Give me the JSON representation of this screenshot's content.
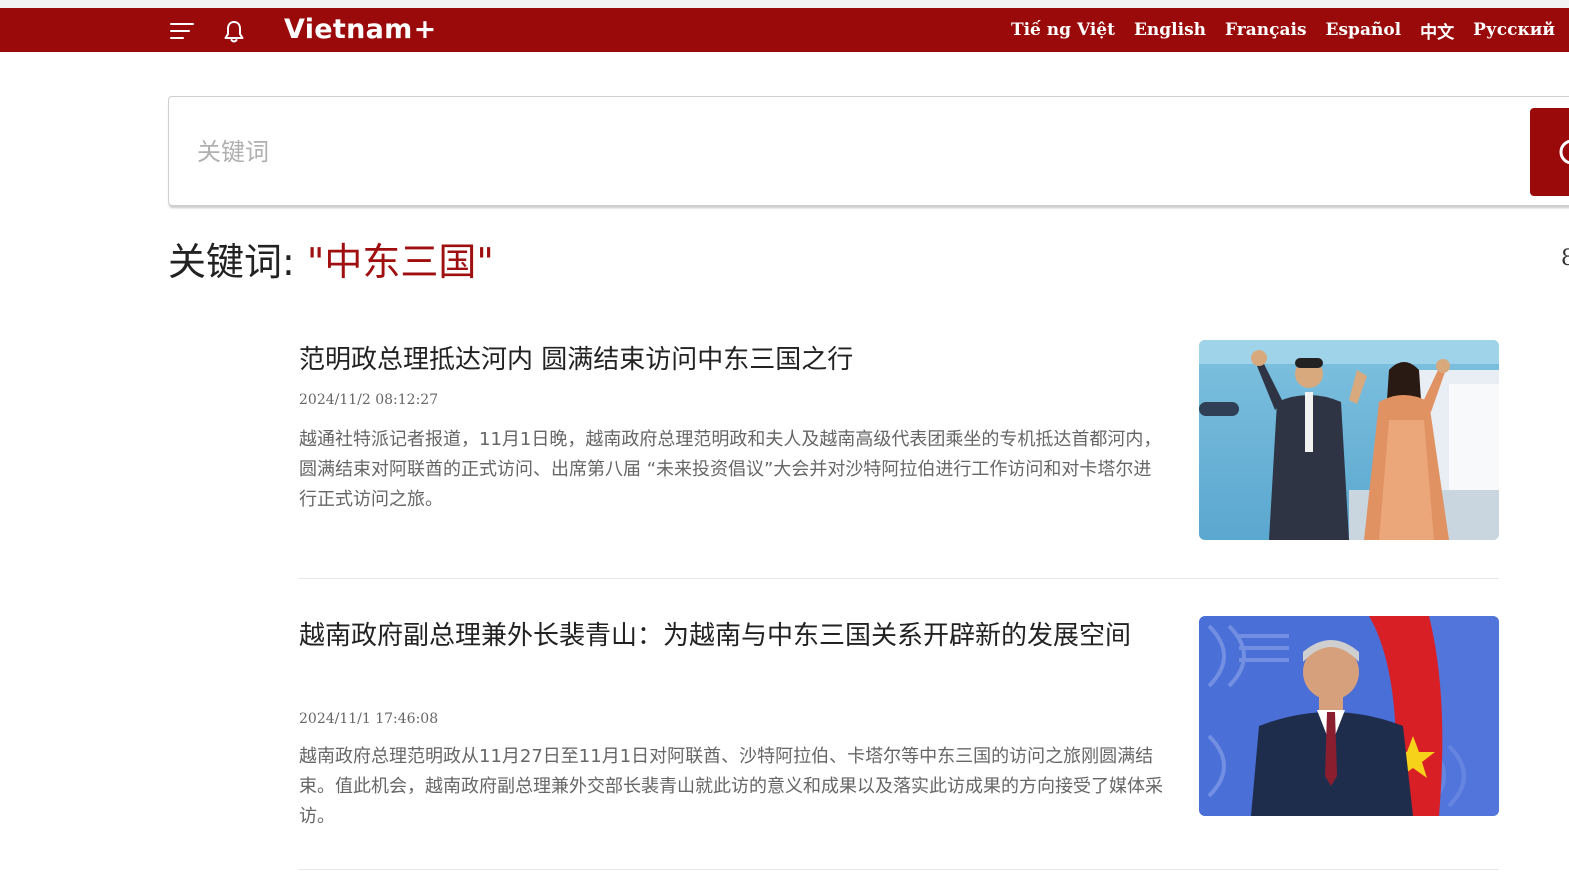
{
  "header": {
    "logo_text": "Vietnam",
    "logo_plus": "+",
    "languages": [
      {
        "label": "Tiế ng Việt"
      },
      {
        "label": "English"
      },
      {
        "label": "Français"
      },
      {
        "label": "Español"
      },
      {
        "label": "中文"
      },
      {
        "label": "Русский"
      }
    ],
    "colors": {
      "brand": "#9b0a0a"
    }
  },
  "search": {
    "placeholder": "关键词",
    "value": ""
  },
  "results": {
    "label_prefix": "关键词: ",
    "keyword": "\"中东三国\"",
    "count_partial": "8"
  },
  "articles": [
    {
      "title": "范明政总理抵达河内 圆满结束访问中东三国之行",
      "date": "2024/11/2 08:12:27",
      "summary": "越通社特派记者报道，11月1日晚，越南政府总理范明政和夫人及越南高级代表团乘坐的专机抵达首都河内，圆满结束对阿联酋的正式访问、出席第八届 “未来投资倡议”大会并对沙特阿拉伯进行工作访问和对卡塔尔进行正式访问之旅。"
    },
    {
      "title": "越南政府副总理兼外长裴青山：为越南与中东三国关系开辟新的发展空间",
      "date": "2024/11/1 17:46:08",
      "summary": "越南政府总理范明政从11月27日至11月1日对阿联酋、沙特阿拉伯、卡塔尔等中东三国的访问之旅刚圆满结束。值此机会，越南政府副总理兼外交部长裴青山就此访的意义和成果以及落实此访成果的方向接受了媒体采访。"
    }
  ]
}
